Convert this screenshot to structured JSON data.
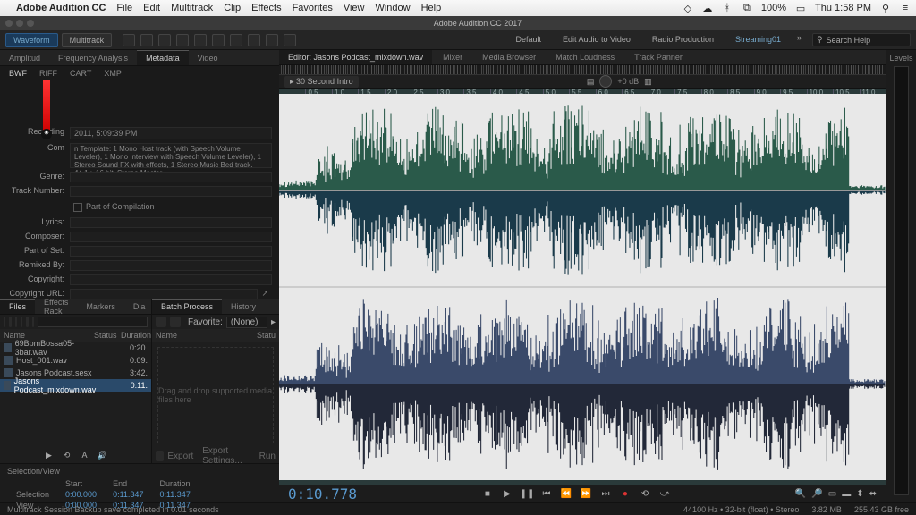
{
  "menubar": {
    "app": "Adobe Audition CC",
    "items": [
      "File",
      "Edit",
      "Multitrack",
      "Clip",
      "Effects",
      "Favorites",
      "View",
      "Window",
      "Help"
    ],
    "clock": "Thu 1:58 PM",
    "battery": "100%"
  },
  "window_title": "Adobe Audition CC 2017",
  "toolbar": {
    "waveform": "Waveform",
    "multitrack": "Multitrack",
    "workspaces": [
      "Default",
      "Edit Audio to Video",
      "Radio Production"
    ],
    "active_workspace": "Streaming01",
    "search_placeholder": "Search Help"
  },
  "meta_tabs": [
    "Amplitud",
    "Frequency Analysis",
    "Metadata",
    "Video"
  ],
  "meta_active": "Metadata",
  "meta_subtabs": [
    "BWF",
    "RIFF",
    "CART",
    "XMP"
  ],
  "meta_sub_active": "BWF",
  "meta": {
    "recording_date": "2011, 5:09:39 PM",
    "comments": "n Template:  1 Mono Host track (with Speech Volume Leveler), 1 Mono Interview with Speech Volume Leveler), 1 Stereo Sound FX with effects, 1 Stereo Music Bed track.  44.1k, 16 bit, Stereo Master.",
    "genre": "",
    "track_number": "",
    "part_of_compilation": "Part of Compilation",
    "lyrics": "",
    "composer": "",
    "part_of_set": "",
    "remixed_by": "",
    "copyright": "",
    "copyright_url": ""
  },
  "meta_labels": {
    "recording_date": "Recording",
    "comments": "Com",
    "genre": "Genre:",
    "track_number": "Track Number:",
    "lyrics": "Lyrics:",
    "composer": "Composer:",
    "part_of_set": "Part of Set:",
    "remixed_by": "Remixed By:",
    "copyright": "Copyright:",
    "copyright_url": "Copyright URL:"
  },
  "files_panel": {
    "tabs": [
      "Files",
      "Effects Rack",
      "Markers",
      "Dia"
    ],
    "columns": [
      "Name",
      "Status",
      "Duration"
    ],
    "rows": [
      {
        "name": "69BpmBossa05-3bar.wav",
        "status": "",
        "dur": "0:20."
      },
      {
        "name": "Host_001.wav",
        "status": "",
        "dur": "0:09."
      },
      {
        "name": "Jasons Podcast.sesx",
        "status": "",
        "dur": "3:42."
      },
      {
        "name": "Jasons Podcast_mixdown.wav",
        "status": "",
        "dur": "0:11.",
        "selected": true
      }
    ]
  },
  "batch_panel": {
    "tabs": [
      "Batch Process",
      "History"
    ],
    "favorite_label": "Favorite:",
    "favorite_value": "(None)",
    "columns": [
      "Name",
      "Statu"
    ],
    "dropzone": "Drag and drop supported media files here",
    "export_btn": "Export Settings...",
    "run_btn": "Run"
  },
  "selview": {
    "title": "Selection/View",
    "cols": [
      "Start",
      "End",
      "Duration"
    ],
    "rows": [
      {
        "label": "Selection",
        "start": "0:00.000",
        "end": "0:11.347",
        "dur": "0:11.347"
      },
      {
        "label": "View",
        "start": "0:00.000",
        "end": "0:11.347",
        "dur": "0:11.347"
      }
    ]
  },
  "editor": {
    "tabs": [
      "Editor: Jasons Podcast_mixdown.wav",
      "Mixer",
      "Media Browser",
      "Match Loudness",
      "Track Panner"
    ],
    "marker": "30 Second Intro",
    "db": "+0 dB",
    "ruler_ticks": [
      "0.5",
      "1.0",
      "1.5",
      "2.0",
      "2.5",
      "3.0",
      "3.5",
      "4.0",
      "4.5",
      "5.0",
      "5.5",
      "6.0",
      "6.5",
      "7.0",
      "7.5",
      "8.0",
      "8.5",
      "9.0",
      "9.5",
      "10.0",
      "10.5",
      "11.0"
    ],
    "timecode": "0:10.778"
  },
  "levels_label": "Levels",
  "statusbar": {
    "msg": "Multitrack Session Backup save completed in 0.01 seconds",
    "sample": "44100 Hz • 32-bit (float) • Stereo",
    "size": "3.82 MB",
    "free": "255.43 GB free"
  }
}
